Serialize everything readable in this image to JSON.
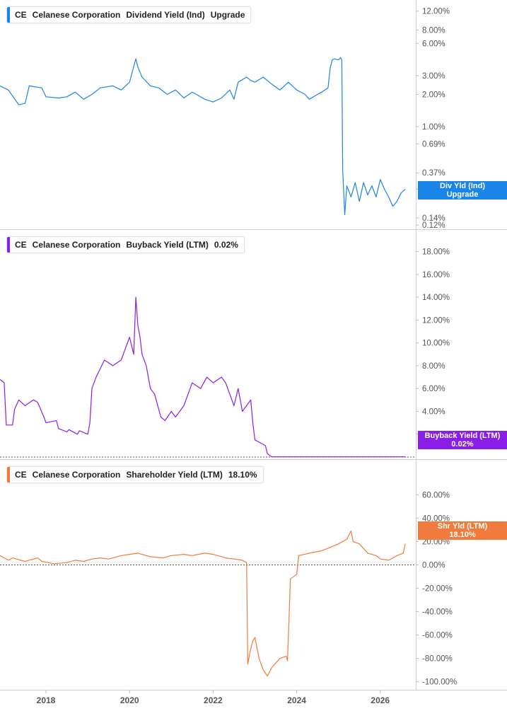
{
  "colors": {
    "dividend": "#1a84e8",
    "buyback": "#8a1ee8",
    "shareholder": "#f07b3c"
  },
  "chart_data": [
    {
      "type": "line",
      "legend": {
        "ticker": "CE",
        "company": "Celanese Corporation",
        "metric": "Dividend Yield (Ind)",
        "value": "Upgrade"
      },
      "flag": [
        "Div Yld (Ind)",
        "Upgrade"
      ],
      "yscale": "log",
      "ylim": [
        0.115,
        13.5
      ],
      "yticks": [
        {
          "v": 12,
          "label": "12.00%"
        },
        {
          "v": 8,
          "label": "8.00%"
        },
        {
          "v": 6,
          "label": "6.00%"
        },
        {
          "v": 3,
          "label": "3.00%"
        },
        {
          "v": 2,
          "label": "2.00%"
        },
        {
          "v": 1,
          "label": "1.00%"
        },
        {
          "v": 0.69,
          "label": "0.69%"
        },
        {
          "v": 0.37,
          "label": "0.37%"
        },
        {
          "v": 0.26,
          "label": "0.26%"
        },
        {
          "v": 0.14,
          "label": "0.14%"
        },
        {
          "v": 0.12,
          "label": "0.12%"
        }
      ],
      "x": [
        2016.9,
        2017.1,
        2017.35,
        2017.5,
        2017.6,
        2017.9,
        2018.0,
        2018.3,
        2018.5,
        2018.7,
        2018.9,
        2019.1,
        2019.3,
        2019.6,
        2019.8,
        2020.0,
        2020.08,
        2020.15,
        2020.2,
        2020.3,
        2020.5,
        2020.7,
        2020.9,
        2021.1,
        2021.3,
        2021.5,
        2021.6,
        2021.8,
        2022.0,
        2022.2,
        2022.4,
        2022.5,
        2022.6,
        2022.8,
        2022.9,
        2023.0,
        2023.2,
        2023.4,
        2023.6,
        2023.8,
        2024.0,
        2024.2,
        2024.3,
        2024.5,
        2024.6,
        2024.75,
        2024.8,
        2024.85,
        2024.9,
        2025.0,
        2025.05,
        2025.08,
        2025.1,
        2025.15,
        2025.2,
        2025.3,
        2025.4,
        2025.5,
        2025.6,
        2025.7,
        2025.8,
        2025.9,
        2026.0,
        2026.1,
        2026.2,
        2026.3,
        2026.4,
        2026.5,
        2026.6
      ],
      "y": [
        2.4,
        2.2,
        1.6,
        1.65,
        2.4,
        2.3,
        1.9,
        1.85,
        1.9,
        2.1,
        1.8,
        2.0,
        2.3,
        2.4,
        2.2,
        2.6,
        3.4,
        4.3,
        3.6,
        2.9,
        2.4,
        2.3,
        2.0,
        2.2,
        1.85,
        2.1,
        2.0,
        1.8,
        1.7,
        1.85,
        2.2,
        1.8,
        2.6,
        2.9,
        2.7,
        2.6,
        2.9,
        2.5,
        2.2,
        2.6,
        2.2,
        2.0,
        1.8,
        2.0,
        2.1,
        2.3,
        3.5,
        4.2,
        4.3,
        4.2,
        4.4,
        4.2,
        0.4,
        0.15,
        0.28,
        0.22,
        0.3,
        0.2,
        0.3,
        0.23,
        0.28,
        0.22,
        0.32,
        0.26,
        0.22,
        0.18,
        0.2,
        0.24,
        0.26
      ]
    },
    {
      "type": "line",
      "legend": {
        "ticker": "CE",
        "company": "Celanese Corporation",
        "metric": "Buyback Yield (LTM)",
        "value": "0.02%"
      },
      "flag": [
        "Buyback Yield (LTM)",
        "0.02%"
      ],
      "yscale": "linear",
      "ylim": [
        0,
        19.4
      ],
      "zero_line": true,
      "yticks": [
        {
          "v": 18,
          "label": "18.00%"
        },
        {
          "v": 16,
          "label": "16.00%"
        },
        {
          "v": 14,
          "label": "14.00%"
        },
        {
          "v": 12,
          "label": "12.00%"
        },
        {
          "v": 10,
          "label": "10.00%"
        },
        {
          "v": 8,
          "label": "8.00%"
        },
        {
          "v": 6,
          "label": "6.00%"
        },
        {
          "v": 4,
          "label": "4.00%"
        },
        {
          "v": 2,
          "label": "2.00%"
        }
      ],
      "x": [
        2016.9,
        2017.0,
        2017.05,
        2017.2,
        2017.25,
        2017.35,
        2017.5,
        2017.7,
        2017.8,
        2017.95,
        2018.0,
        2018.25,
        2018.3,
        2018.5,
        2018.55,
        2018.75,
        2018.8,
        2019.0,
        2019.05,
        2019.1,
        2019.2,
        2019.4,
        2019.6,
        2019.8,
        2020.0,
        2020.1,
        2020.15,
        2020.2,
        2020.25,
        2020.3,
        2020.4,
        2020.5,
        2020.6,
        2020.75,
        2020.85,
        2021.0,
        2021.1,
        2021.3,
        2021.5,
        2021.7,
        2021.85,
        2022.0,
        2022.2,
        2022.3,
        2022.4,
        2022.5,
        2022.6,
        2022.7,
        2022.8,
        2022.9,
        2022.95,
        2023.0,
        2023.1,
        2023.25,
        2023.3,
        2023.4,
        2026.6
      ],
      "y": [
        6.8,
        6.5,
        2.8,
        2.8,
        4.2,
        5.0,
        4.5,
        5.0,
        4.8,
        3.5,
        3.0,
        3.2,
        2.5,
        2.2,
        2.4,
        2.0,
        2.3,
        2.0,
        3.0,
        6.0,
        7.0,
        8.5,
        8.0,
        8.5,
        10.5,
        9.0,
        14.0,
        11.5,
        10.5,
        9.0,
        8.0,
        6.0,
        5.5,
        3.5,
        3.2,
        4.0,
        3.5,
        4.5,
        6.5,
        6.0,
        7.0,
        6.5,
        7.0,
        6.5,
        5.5,
        4.5,
        6.0,
        4.0,
        4.5,
        5.0,
        3.0,
        1.5,
        1.3,
        1.0,
        0.3,
        0.02,
        0.02
      ]
    },
    {
      "type": "line",
      "legend": {
        "ticker": "CE",
        "company": "Celanese Corporation",
        "metric": "Shareholder Yield (LTM)",
        "value": "18.10%"
      },
      "flag": [
        "Shr Yld (LTM)",
        "18.10%"
      ],
      "yscale": "linear",
      "ylim": [
        -105,
        85
      ],
      "zero_line": true,
      "yticks": [
        {
          "v": 60,
          "label": "60.00%"
        },
        {
          "v": 40,
          "label": "40.00%"
        },
        {
          "v": 20,
          "label": "20.00%"
        },
        {
          "v": 0,
          "label": "0.00%"
        },
        {
          "v": -20,
          "label": "-20.00%"
        },
        {
          "v": -40,
          "label": "-40.00%"
        },
        {
          "v": -60,
          "label": "-60.00%"
        },
        {
          "v": -80,
          "label": "-80.00%"
        },
        {
          "v": -100,
          "label": "-100.00%"
        }
      ],
      "x": [
        2016.9,
        2017.1,
        2017.2,
        2017.4,
        2017.5,
        2017.7,
        2017.8,
        2017.9,
        2018.2,
        2018.5,
        2018.7,
        2018.9,
        2019.1,
        2019.3,
        2019.5,
        2019.8,
        2020.0,
        2020.2,
        2020.5,
        2020.8,
        2021.0,
        2021.3,
        2021.5,
        2021.8,
        2022.0,
        2022.3,
        2022.5,
        2022.7,
        2022.8,
        2022.83,
        2022.88,
        2022.95,
        2023.0,
        2023.1,
        2023.2,
        2023.3,
        2023.4,
        2023.6,
        2023.75,
        2023.78,
        2023.85,
        2024.0,
        2024.05,
        2024.3,
        2024.6,
        2024.8,
        2025.0,
        2025.2,
        2025.3,
        2025.35,
        2025.5,
        2025.7,
        2025.9,
        2026.0,
        2026.2,
        2026.4,
        2026.55,
        2026.6
      ],
      "y": [
        8.0,
        4.0,
        6.0,
        4.0,
        3.0,
        5.0,
        6.0,
        3.0,
        1.0,
        2.0,
        4.0,
        3.0,
        5.0,
        6.0,
        5.0,
        8.0,
        9.0,
        10.0,
        7.0,
        6.0,
        8.0,
        9.0,
        8.0,
        10.0,
        9.0,
        6.0,
        5.0,
        4.0,
        2.0,
        -85.0,
        -75.0,
        -65.0,
        -62.0,
        -80.0,
        -90.0,
        -95.0,
        -88.0,
        -80.0,
        -78.0,
        -82.0,
        -12.0,
        -8.0,
        8.0,
        10.0,
        12.0,
        15.0,
        18.0,
        22.0,
        29.0,
        20.0,
        18.0,
        10.0,
        8.0,
        5.0,
        4.0,
        8.0,
        10.0,
        18.1
      ]
    }
  ],
  "xaxis": {
    "range": [
      2016.9,
      2026.85
    ],
    "ticks": [
      {
        "v": 2018,
        "label": "2018"
      },
      {
        "v": 2020,
        "label": "2020"
      },
      {
        "v": 2022,
        "label": "2022"
      },
      {
        "v": 2024,
        "label": "2024"
      },
      {
        "v": 2026,
        "label": "2026"
      }
    ]
  }
}
